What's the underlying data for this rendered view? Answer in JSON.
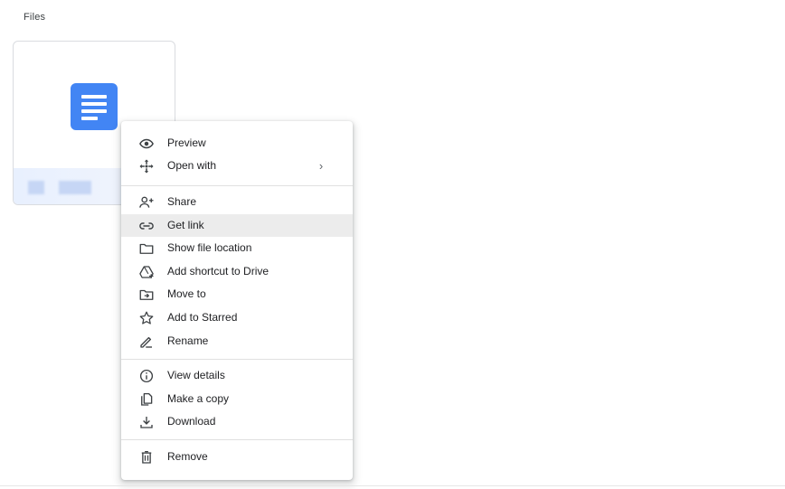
{
  "section": {
    "title": "Files"
  },
  "file_card": {
    "icon": "google-docs-icon",
    "icon_color": "#4285f4"
  },
  "context_menu": {
    "hover_color": "#ececec",
    "items": [
      {
        "label": "Preview",
        "icon": "eye-icon"
      },
      {
        "label": "Open with",
        "icon": "move-arrows-icon",
        "submenu_indicator": "›"
      },
      {
        "label": "Share",
        "icon": "add-person-icon"
      },
      {
        "label": "Get link",
        "icon": "link-icon",
        "hovered": true
      },
      {
        "label": "Show file location",
        "icon": "folder-icon"
      },
      {
        "label": "Add shortcut to Drive",
        "icon": "drive-shortcut-icon"
      },
      {
        "label": "Move to",
        "icon": "move-to-folder-icon"
      },
      {
        "label": "Add to Starred",
        "icon": "star-icon"
      },
      {
        "label": "Rename",
        "icon": "pencil-icon"
      },
      {
        "label": "View details",
        "icon": "info-icon"
      },
      {
        "label": "Make a copy",
        "icon": "copy-icon"
      },
      {
        "label": "Download",
        "icon": "download-icon"
      },
      {
        "label": "Remove",
        "icon": "trash-icon"
      }
    ]
  }
}
